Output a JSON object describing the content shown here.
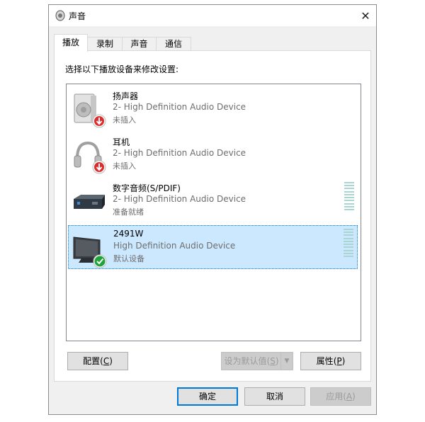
{
  "window": {
    "title": "声音",
    "close_glyph": "✕"
  },
  "tabs": [
    {
      "label": "播放",
      "active": true
    },
    {
      "label": "录制",
      "active": false
    },
    {
      "label": "声音",
      "active": false
    },
    {
      "label": "通信",
      "active": false
    }
  ],
  "panel": {
    "instruction": "选择以下播放设备来修改设置:"
  },
  "devices": [
    {
      "name": "扬声器",
      "description": "2- High Definition Audio Device",
      "status": "未插入",
      "icon": "speaker-icon",
      "badge": "red-down-arrow-badge"
    },
    {
      "name": "耳机",
      "description": "2- High Definition Audio Device",
      "status": "未插入",
      "icon": "headphones-icon",
      "badge": "red-down-arrow-badge"
    },
    {
      "name": "数字音频(S/PDIF)",
      "description": "2- High Definition Audio Device",
      "status": "准备就绪",
      "icon": "digital-audio-icon",
      "badge": ""
    },
    {
      "name": "2491W",
      "description": "High Definition Audio Device",
      "status": "默认设备",
      "icon": "monitor-icon",
      "badge": "green-check-badge",
      "selected": true
    }
  ],
  "buttons": {
    "configure": {
      "label": "配置",
      "hotkey": "C"
    },
    "set_default": {
      "label": "设为默认值",
      "hotkey": "S"
    },
    "properties": {
      "label": "属性",
      "hotkey": "P"
    },
    "ok": "确定",
    "cancel": "取消",
    "apply": {
      "label": "应用",
      "hotkey": "A"
    }
  },
  "colors": {
    "selection": "#cce8ff",
    "accent": "#0078d7",
    "meter": "#a9d6d2",
    "status_gray": "#6d6d6d"
  }
}
